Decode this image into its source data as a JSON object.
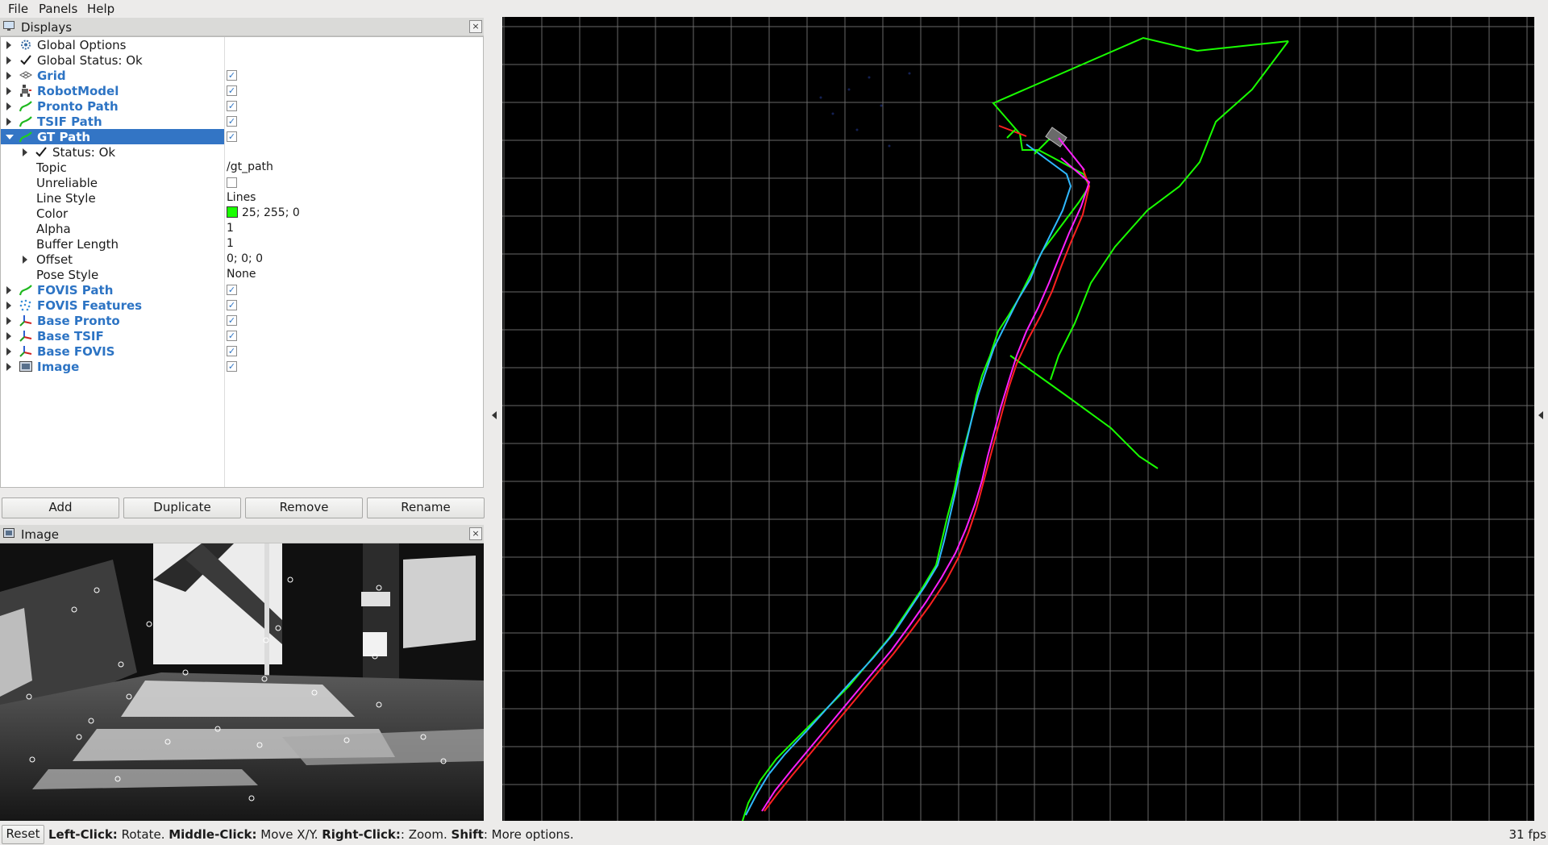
{
  "menu": {
    "file": "File",
    "panels": "Panels",
    "help": "Help"
  },
  "displays_panel": {
    "title": "Displays",
    "close": "×",
    "rows": [
      {
        "label": "Global Options",
        "icon": "gear-icon",
        "value": ""
      },
      {
        "label": "Global Status: Ok",
        "icon": "check-icon",
        "value": ""
      },
      {
        "label": "Grid",
        "icon": "grid-icon",
        "checked": true
      },
      {
        "label": "RobotModel",
        "icon": "robot-icon",
        "checked": true
      },
      {
        "label": "Pronto Path",
        "icon": "path-icon",
        "checked": true
      },
      {
        "label": "TSIF Path",
        "icon": "path-icon",
        "checked": true
      },
      {
        "label": "GT Path",
        "icon": "path-icon",
        "checked": true,
        "selected": true
      },
      {
        "label": "Status: Ok",
        "icon": "check-icon",
        "value": ""
      },
      {
        "label": "Topic",
        "value": "/gt_path"
      },
      {
        "label": "Unreliable",
        "checked": false
      },
      {
        "label": "Line Style",
        "value": "Lines"
      },
      {
        "label": "Color",
        "value": "25; 255; 0",
        "color": "#19ff00"
      },
      {
        "label": "Alpha",
        "value": "1"
      },
      {
        "label": "Buffer Length",
        "value": "1"
      },
      {
        "label": "Offset",
        "value": "0; 0; 0"
      },
      {
        "label": "Pose Style",
        "value": "None"
      },
      {
        "label": "FOVIS Path",
        "icon": "path-icon",
        "checked": true
      },
      {
        "label": "FOVIS Features",
        "icon": "pointcloud-icon",
        "checked": true
      },
      {
        "label": "Base Pronto",
        "icon": "axes-icon",
        "checked": true
      },
      {
        "label": "Base TSIF",
        "icon": "axes-icon",
        "checked": true
      },
      {
        "label": "Base FOVIS",
        "icon": "axes-icon",
        "checked": true
      },
      {
        "label": "Image",
        "icon": "image-icon",
        "checked": true
      }
    ],
    "checkmark": "✓"
  },
  "buttons": {
    "add": "Add",
    "duplicate": "Duplicate",
    "remove": "Remove",
    "rename": "Rename"
  },
  "image_panel": {
    "title": "Image",
    "close": "×"
  },
  "status_bar": {
    "reset": "Reset",
    "hint_left_key": "Left-Click:",
    "hint_left": " Rotate. ",
    "hint_middle_key": "Middle-Click:",
    "hint_middle": " Move X/Y. ",
    "hint_right_key": "Right-Click:",
    "hint_right": ": Zoom. ",
    "hint_shift_key": "Shift",
    "hint_shift": ": More options.",
    "fps": "31 fps"
  },
  "colors": {
    "selection": "#3375c5",
    "display_label": "#2d74c4",
    "gt_path": "#19ff00",
    "tsif_path": "#2fb8ff",
    "pronto_path": "#ff2020",
    "fovis_path": "#ff20ff",
    "grid": "#a0a0a0"
  }
}
